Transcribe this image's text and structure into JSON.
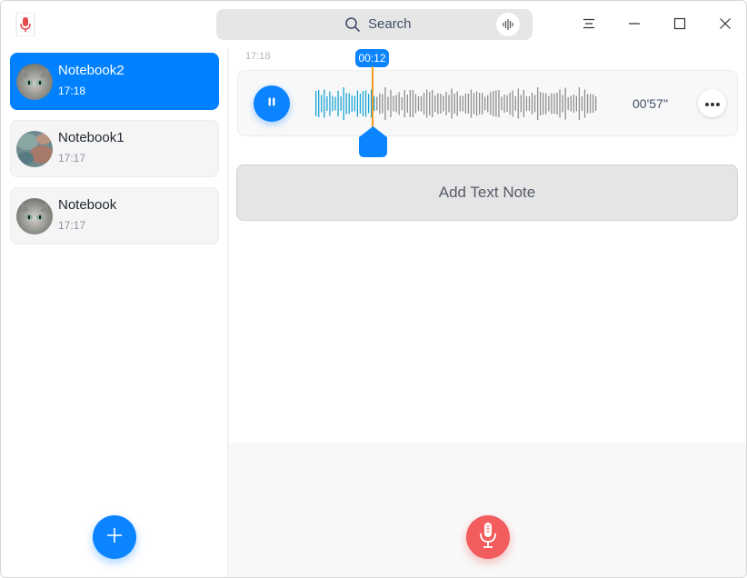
{
  "app": {
    "icon": "voice-notes-app-icon"
  },
  "search": {
    "placeholder": "Search",
    "icon": "search-icon",
    "voice_icon": "voice-input-icon"
  },
  "window_controls": {
    "menu_icon": "hamburger-menu-icon",
    "minimize_icon": "minimize-icon",
    "maximize_icon": "maximize-icon",
    "close_icon": "close-icon"
  },
  "sidebar": {
    "items": [
      {
        "title": "Notebook2",
        "time": "17:18",
        "avatar": "cat-avatar",
        "active": true
      },
      {
        "title": "Notebook1",
        "time": "17:17",
        "avatar": "mineral-avatar",
        "active": false
      },
      {
        "title": "Notebook",
        "time": "17:17",
        "avatar": "cat-avatar",
        "active": false
      }
    ],
    "add_icon": "plus-icon"
  },
  "main": {
    "recording": {
      "time": "17:18",
      "cursor_time": "00:12",
      "duration": "00'57''",
      "played_fraction": 0.21
    },
    "add_text_label": "Add Text Note",
    "record_icon": "microphone-icon"
  },
  "colors": {
    "accent": "#0081ff",
    "record": "#f25c5c",
    "playhead": "#f59a23"
  }
}
